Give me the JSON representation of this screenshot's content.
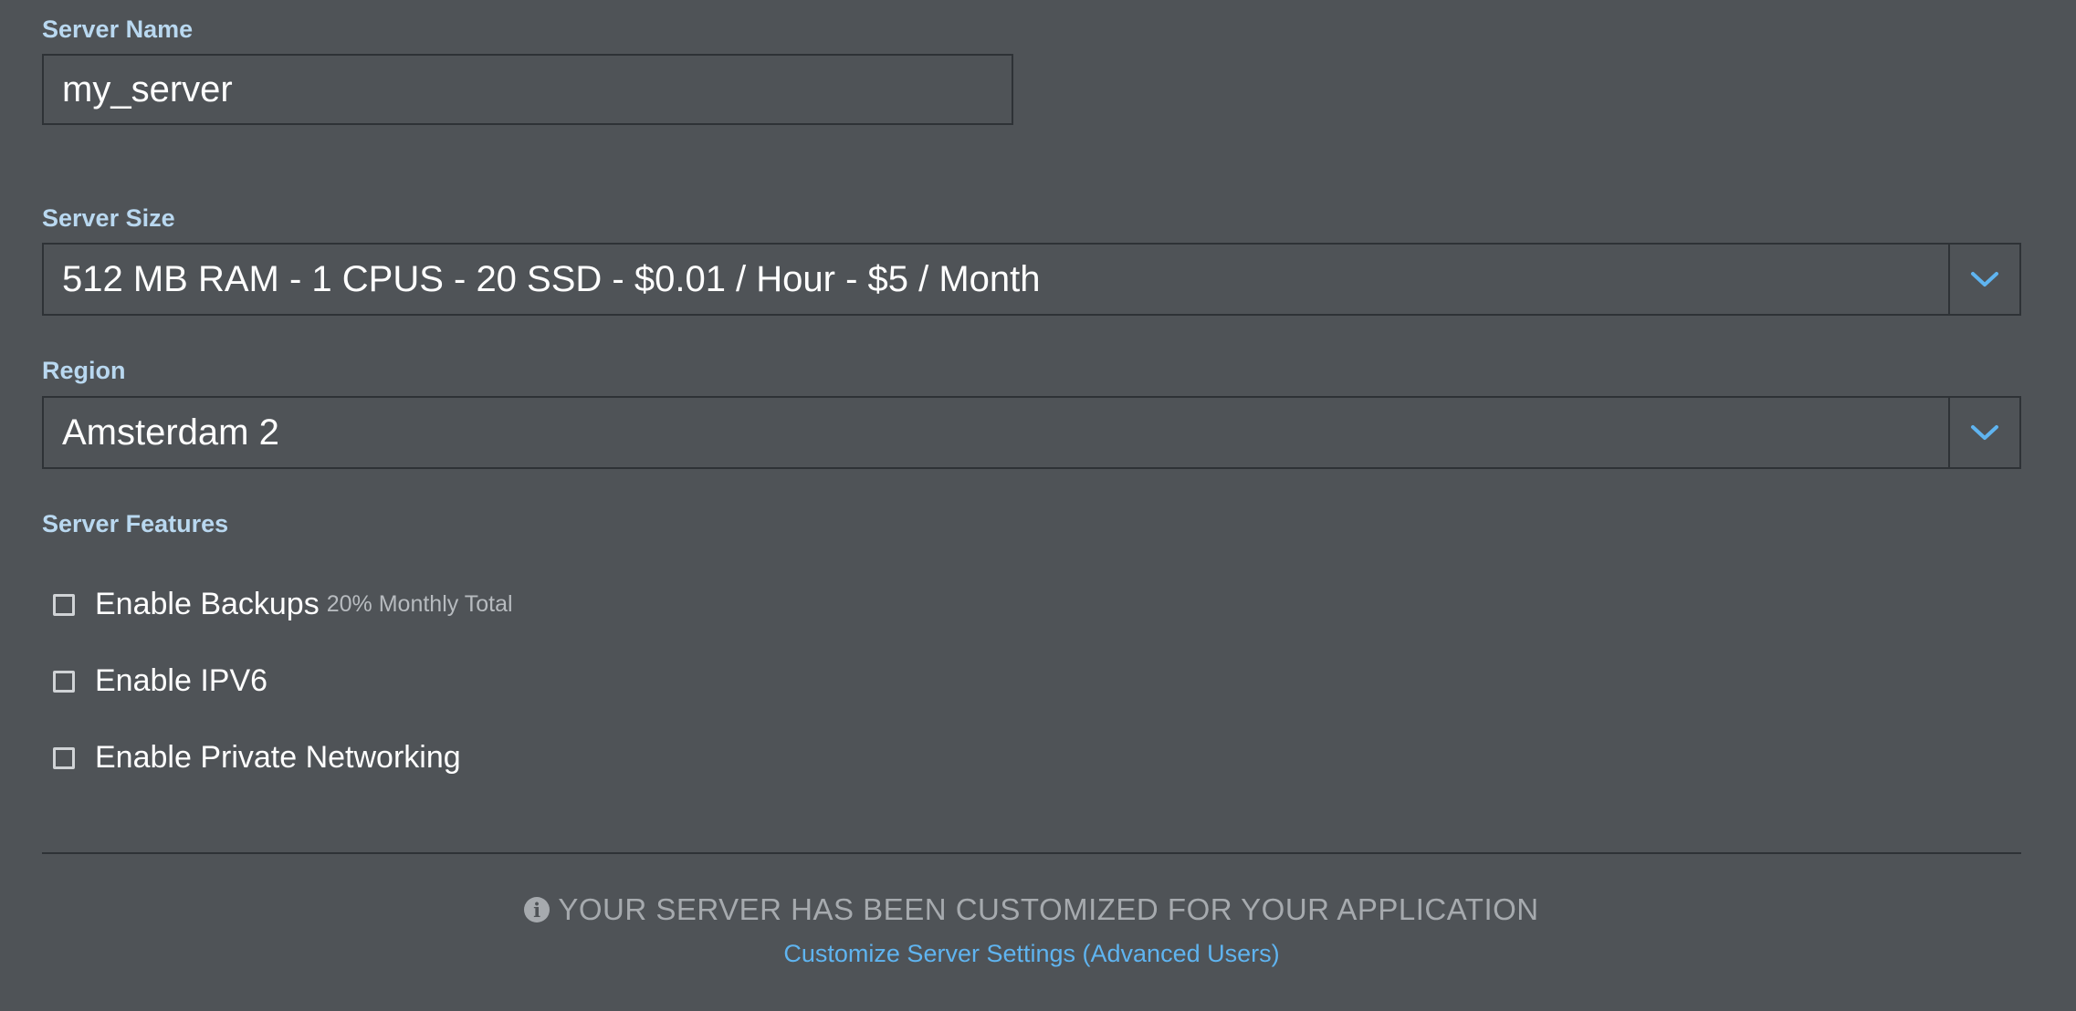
{
  "server_name": {
    "label": "Server Name",
    "value": "my_server"
  },
  "server_size": {
    "label": "Server Size",
    "selected": "512 MB RAM - 1 CPUS - 20 SSD - $0.01 / Hour - $5 / Month",
    "caret_icon": "chevron-down-icon"
  },
  "region": {
    "label": "Region",
    "selected": "Amsterdam 2",
    "caret_icon": "chevron-down-icon"
  },
  "features": {
    "label": "Server Features",
    "items": [
      {
        "label": "Enable Backups",
        "note": "20% Monthly Total",
        "checked": false
      },
      {
        "label": "Enable IPV6",
        "checked": false
      },
      {
        "label": "Enable Private Networking",
        "checked": false
      }
    ]
  },
  "notice": {
    "icon": "info-circle-icon",
    "text": "YOUR SERVER HAS BEEN CUSTOMIZED FOR YOUR APPLICATION"
  },
  "advanced_link": "Customize Server Settings (Advanced Users)",
  "colors": {
    "background": "#4f5357",
    "label": "#b9d8f0",
    "accent": "#5fb4f0",
    "border": "#2e3236",
    "muted": "#a6aaae"
  }
}
